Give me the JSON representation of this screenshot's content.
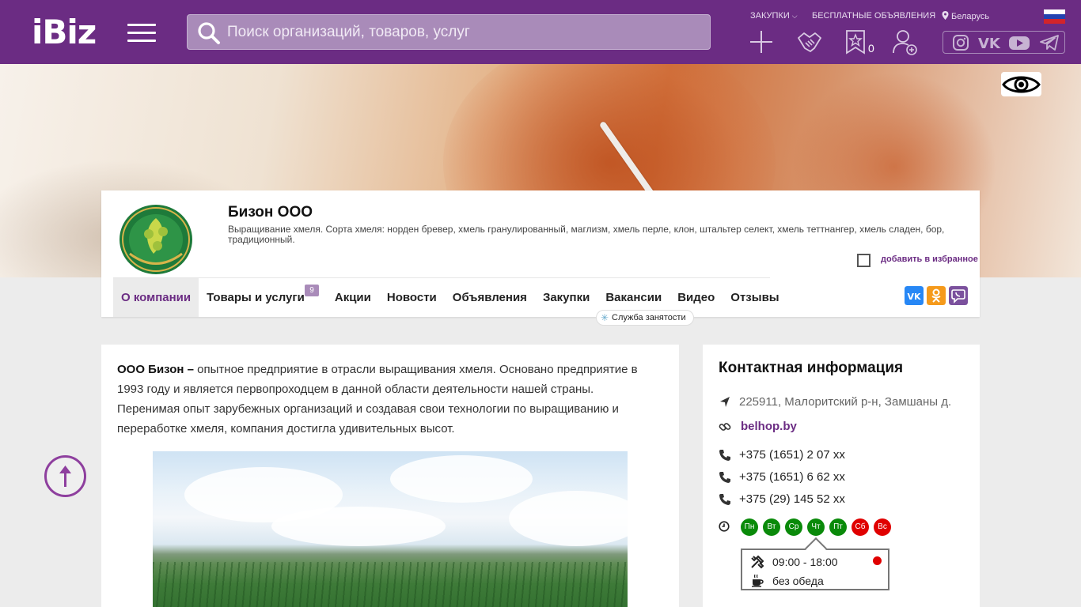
{
  "header": {
    "logo": "iBiz",
    "search_placeholder": "Поиск организаций, товаров, услуг",
    "links": {
      "zakupki": "ЗАКУПКИ",
      "free_ads": "БЕСПЛАТНЫЕ ОБЪЯВЛЕНИЯ",
      "region": "Беларусь"
    },
    "favorites_count": "0",
    "colors": {
      "bg": "#6b2c83",
      "search_bg": "#a98bb9"
    }
  },
  "company": {
    "name": "Бизон ООО",
    "description": "Выращивание хмеля. Сорта хмеля: норден бревер, хмель гранулированный, маглизм, хмель перле, клон, штальтер селект, хмель теттнангер, хмель сладен, бор, традиционный.",
    "add_favorite": "добавить в избранное"
  },
  "tabs": [
    {
      "label": "О компании",
      "active": true
    },
    {
      "label": "Товары и услуги",
      "badge": "9"
    },
    {
      "label": "Акции"
    },
    {
      "label": "Новости"
    },
    {
      "label": "Объявления"
    },
    {
      "label": "Закупки"
    },
    {
      "label": "Вакансии"
    },
    {
      "label": "Видео"
    },
    {
      "label": "Отзывы"
    }
  ],
  "job_tip": "Служба занятости",
  "about": {
    "lead": "ООО Бизон –",
    "text": " опытное предприятие в отрасли выращивания хмеля. Основано предприятие в 1993 году и является первопроходцем в данной области деятельности нашей страны. Перенимая опыт зарубежных организаций и создавая свои технологии по выращиванию и переработке хмеля, компания достигла удивительных высот."
  },
  "contacts": {
    "title": "Контактная информация",
    "address": "225911, Малоритский р-н, Замшаны д.",
    "site": "belhop.by",
    "phones": [
      "+375 (1651) 2 07 xx",
      "+375 (1651) 6 62 xx",
      "+375 (29) 145 52 xx"
    ],
    "days": [
      {
        "label": "Пн",
        "open": true
      },
      {
        "label": "Вт",
        "open": true
      },
      {
        "label": "Ср",
        "open": true
      },
      {
        "label": "Чт",
        "open": true
      },
      {
        "label": "Пт",
        "open": true
      },
      {
        "label": "Сб",
        "open": false
      },
      {
        "label": "Вс",
        "open": false
      }
    ],
    "hours": "09:00 - 18:00",
    "lunch": "без обеда",
    "status_color": "#e00000"
  },
  "social_share": [
    "vk",
    "odnoklassniki",
    "viber"
  ],
  "social_header": [
    "instagram",
    "vk",
    "youtube",
    "telegram"
  ]
}
